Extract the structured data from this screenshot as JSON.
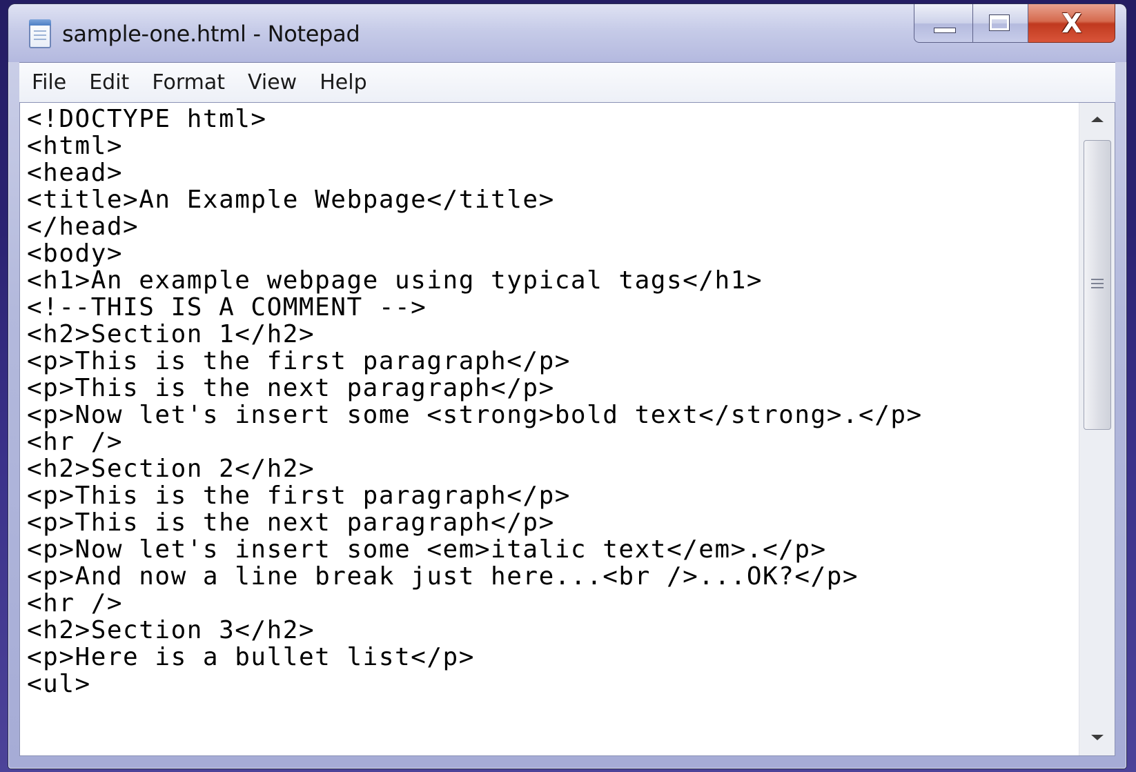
{
  "window": {
    "title": "sample-one.html - Notepad",
    "icon": "notepad-icon",
    "controls": {
      "minimize": "minimize-icon",
      "maximize": "maximize-icon",
      "close": "X"
    }
  },
  "menu": [
    "File",
    "Edit",
    "Format",
    "View",
    "Help"
  ],
  "editor": {
    "lines": [
      "<!DOCTYPE html>",
      "<html>",
      "<head>",
      "<title>An Example Webpage</title>",
      "</head>",
      "<body>",
      "<h1>An example webpage using typical tags</h1>",
      "<!--THIS IS A COMMENT -->",
      "<h2>Section 1</h2>",
      "<p>This is the first paragraph</p>",
      "<p>This is the next paragraph</p>",
      "<p>Now let's insert some <strong>bold text</strong>.</p>",
      "<hr />",
      "<h2>Section 2</h2>",
      "<p>This is the first paragraph</p>",
      "<p>This is the next paragraph</p>",
      "<p>Now let's insert some <em>italic text</em>.</p>",
      "<p>And now a line break just here...<br />...OK?</p>",
      "<hr />",
      "<h2>Section 3</h2>",
      "<p>Here is a bullet list</p>",
      "<ul>"
    ]
  },
  "scrollbar": {
    "up": "scroll-up-arrow-icon",
    "down": "scroll-down-arrow-icon",
    "grip": "grip-icon"
  }
}
